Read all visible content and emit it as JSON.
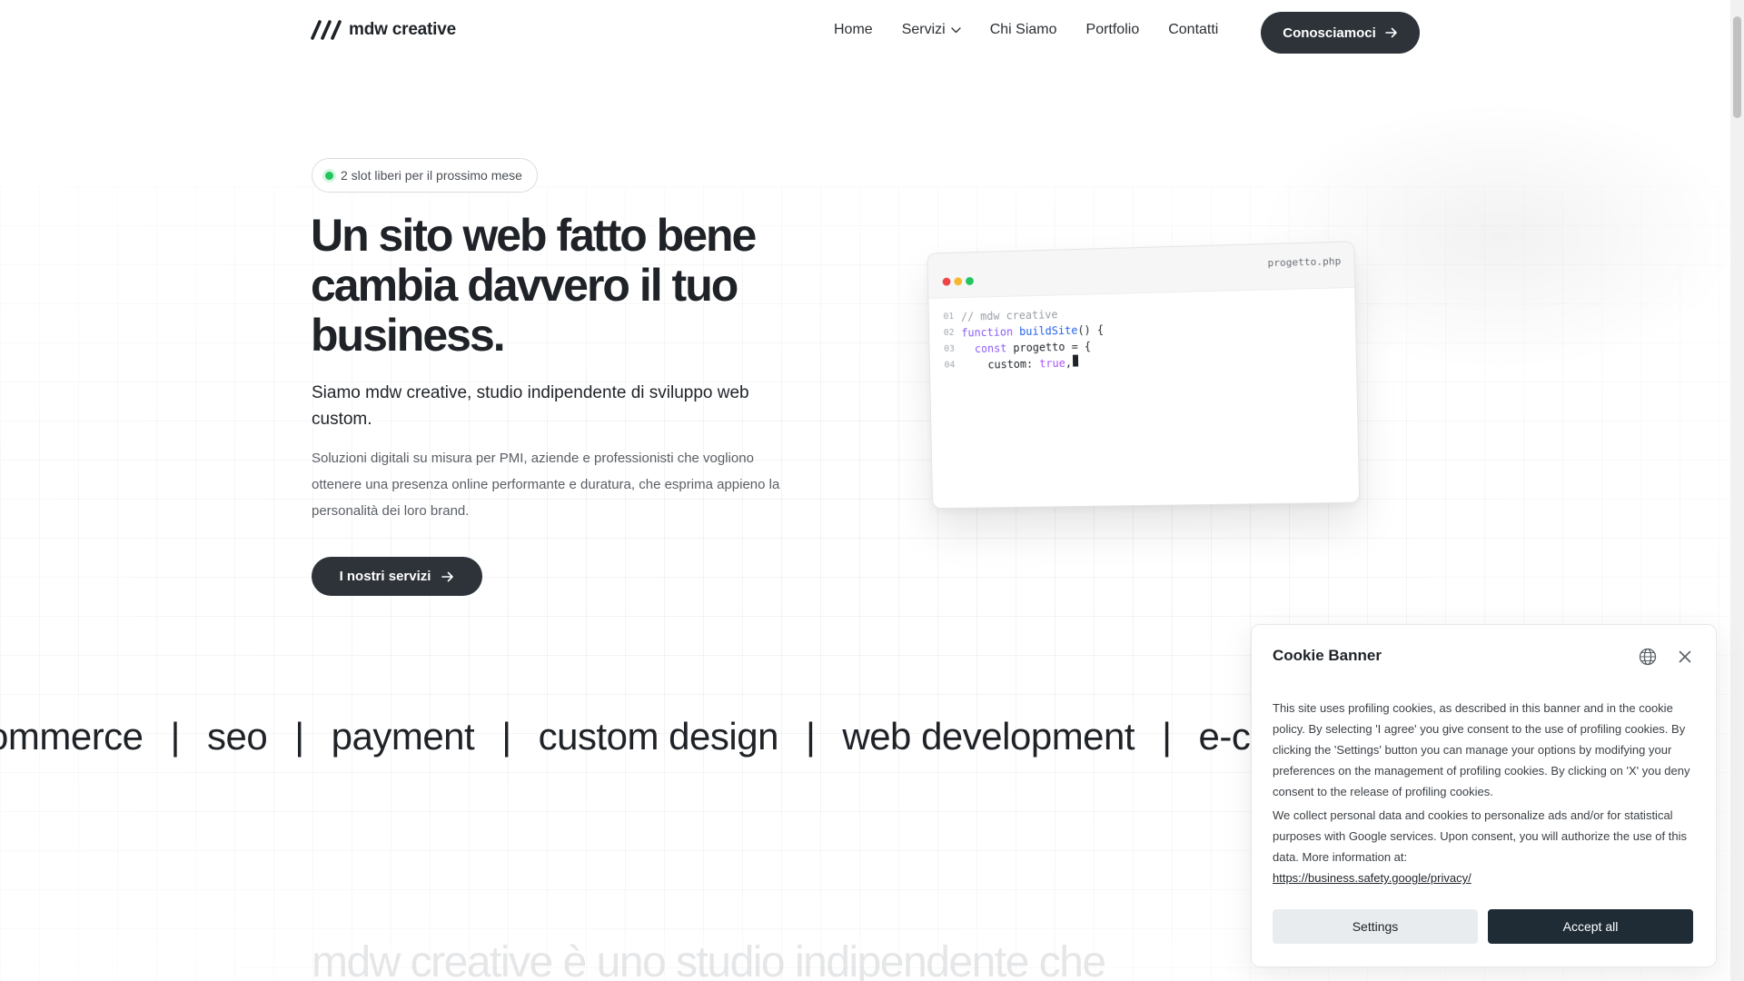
{
  "header": {
    "logo_text": "mdw creative",
    "nav": [
      {
        "label": "Home"
      },
      {
        "label": "Servizi"
      },
      {
        "label": "Chi Siamo"
      },
      {
        "label": "Portfolio"
      },
      {
        "label": "Contatti"
      }
    ],
    "cta_label": "Conosciamoci"
  },
  "hero": {
    "badge": "2 slot liberi per il prossimo mese",
    "title": "Un sito web fatto bene cambia davvero il tuo business.",
    "subtitle": "Siamo mdw creative, studio indipendente di sviluppo web custom.",
    "description": "Soluzioni digitali su misura per PMI, aziende e professionisti che vogliono ottenere una presenza online performante e duratura, che esprima appieno la personalità dei loro brand.",
    "cta_label": "I nostri servizi"
  },
  "code_window": {
    "filename": "progetto.php",
    "lines": [
      {
        "num": "01",
        "comment": "// mdw creative"
      },
      {
        "num": "02",
        "kw": "function",
        "fn": "buildSite",
        "rest": "() {"
      },
      {
        "num": "03",
        "kw": "const",
        "rest": " progetto = {"
      },
      {
        "num": "04",
        "key": "custom: ",
        "bool": "true",
        "end": ","
      }
    ]
  },
  "marquee": {
    "items": [
      "ommerce",
      "seo",
      "payment",
      "custom design",
      "web development",
      "e-commerce"
    ],
    "separator": "|"
  },
  "bottom_heading": "mdw creative è uno studio indipendente che",
  "cookie": {
    "title": "Cookie Banner",
    "paragraph1": "This site uses profiling cookies, as described in this banner and in the cookie policy. By selecting 'I agree' you give consent to the use of profiling cookies. By clicking the 'Settings' button you can manage your options by modifying your preferences on the management of profiling cookies. By clicking on 'X' you deny consent to the release of profiling cookies.",
    "paragraph2": "We collect personal data and cookies to personalize ads and/or for statistical purposes with Google services. Upon consent, you will authorize the use of this data. More information at:",
    "link": "https://business.safety.google/privacy/",
    "settings_label": "Settings",
    "accept_label": "Accept all"
  },
  "icons": {
    "logo": "slashes-logo-icon",
    "nav_dropdown": "chevron-down-icon",
    "cta_arrow": "arrow-right-icon",
    "language": "globe-icon",
    "close": "close-icon"
  },
  "colors": {
    "primary_dark": "#2d3338",
    "accept_button": "#1f2b35",
    "status_green": "#22c55e"
  }
}
